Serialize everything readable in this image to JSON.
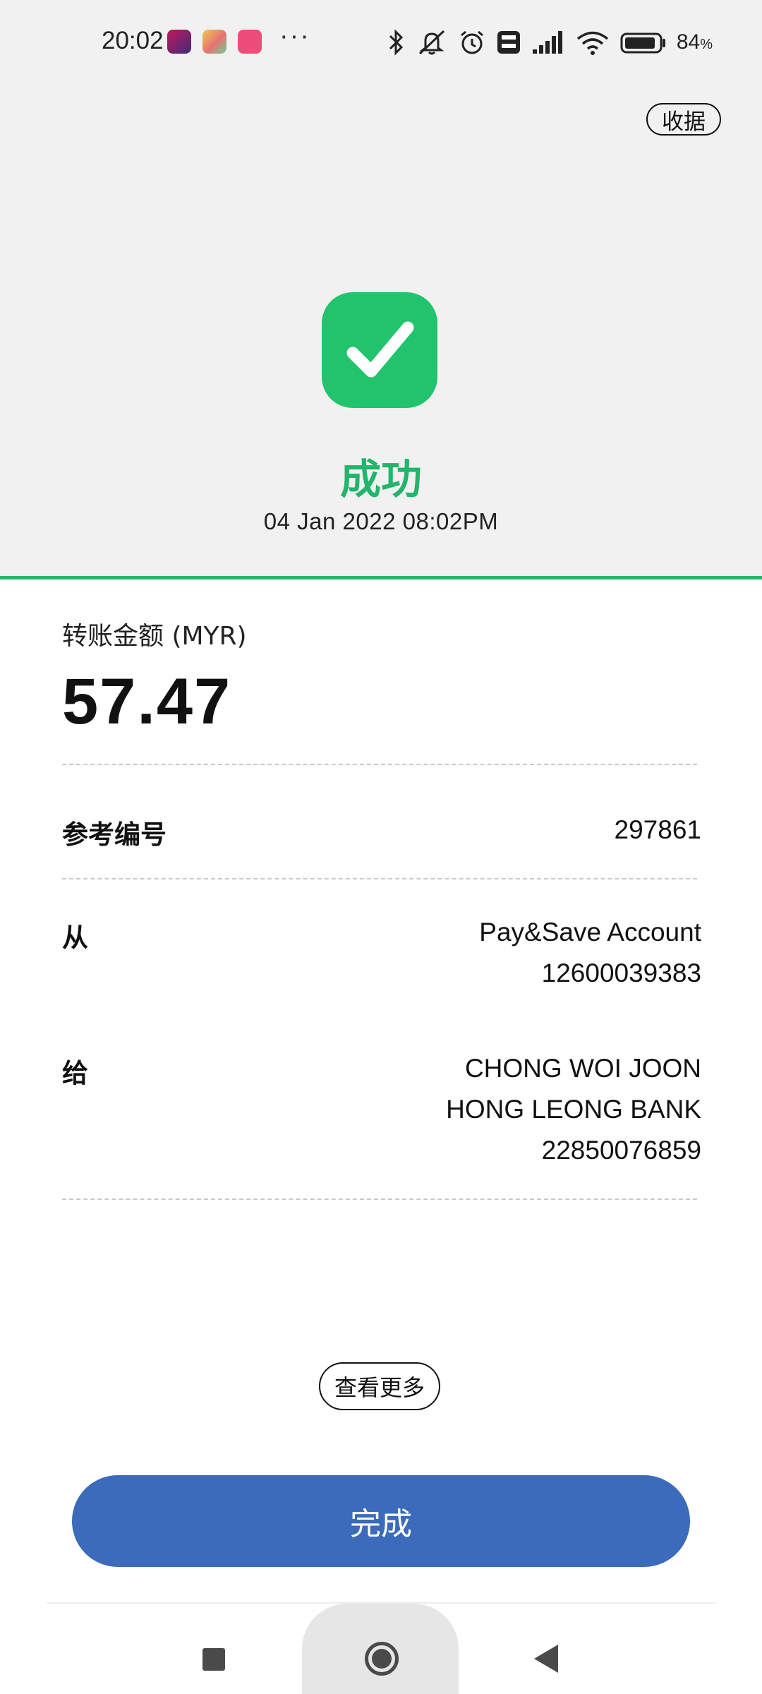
{
  "status_bar": {
    "time": "20:02",
    "more_dots": "···",
    "battery_percent": "84",
    "battery_unit": "%",
    "icons": [
      "bluetooth-icon",
      "mute-icon",
      "alarm-icon",
      "volte-icon",
      "signal-icon",
      "wifi-icon",
      "battery-icon"
    ]
  },
  "header": {
    "receipt_label": "收据"
  },
  "result": {
    "status_label": "成功",
    "datetime": "04 Jan 2022 08:02PM",
    "accent_color": "#22b56b"
  },
  "amount": {
    "label": "转账金额 (MYR)",
    "value": "57.47"
  },
  "details": {
    "reference": {
      "label": "参考编号",
      "value": "297861"
    },
    "from": {
      "label": "从",
      "line1": "Pay&Save Account",
      "line2": "12600039383"
    },
    "to": {
      "label": "给",
      "line1": "CHONG WOI JOON",
      "line2": "HONG LEONG BANK",
      "line3": "22850076859"
    }
  },
  "actions": {
    "more_label": "查看更多",
    "done_label": "完成",
    "done_color": "#3b6bba"
  }
}
